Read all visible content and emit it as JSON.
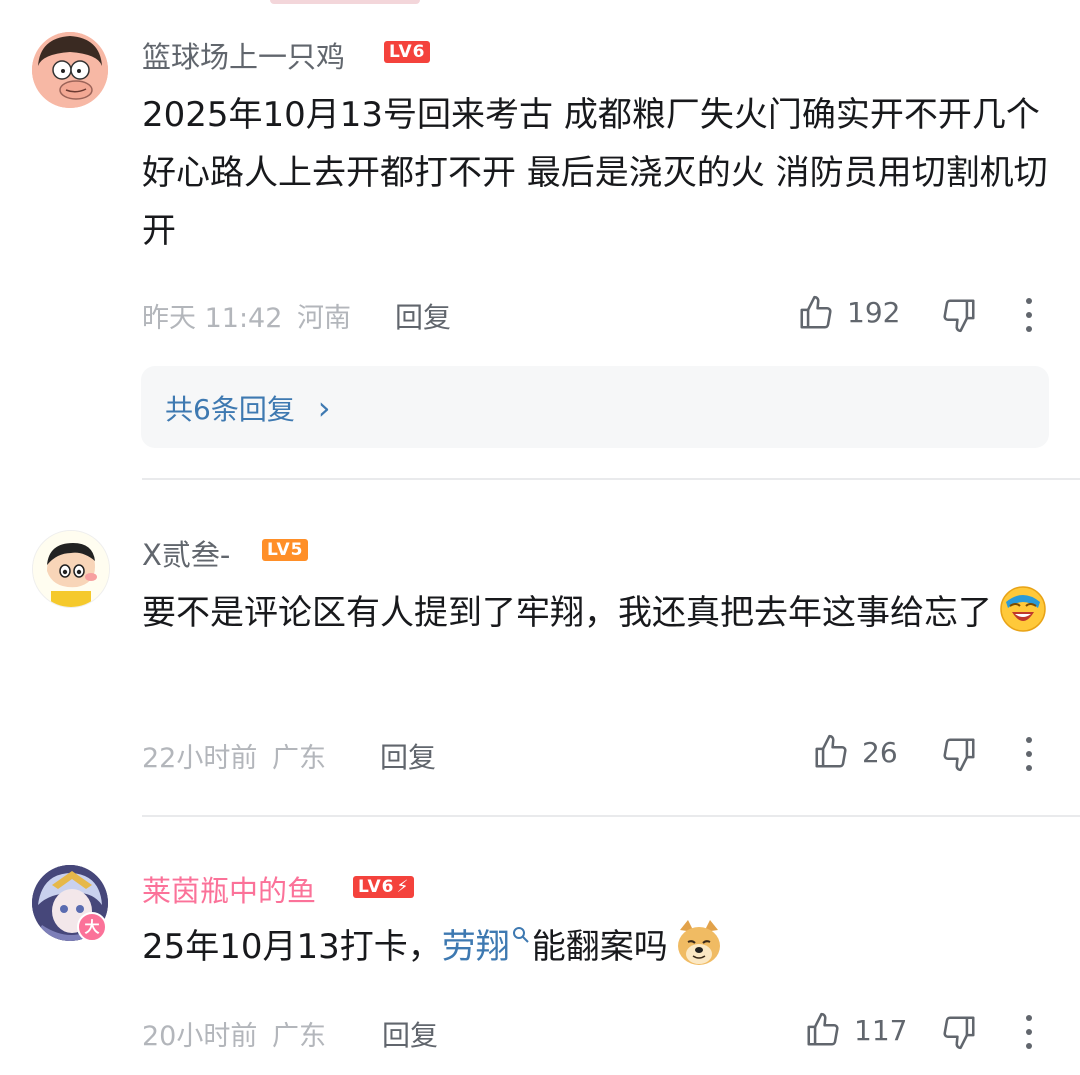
{
  "comments": [
    {
      "username": "篮球场上一只鸡",
      "level": "LV6",
      "text": "2025年10月13号回来考古 成都粮厂失火门确实开不开几个好心路人上去开都打不开 最后是浇灭的火 消防员用切割机切开",
      "time": "昨天 11:42",
      "location": "河南",
      "reply_label": "回复",
      "likes": "192",
      "replies_summary": "共6条回复",
      "replies_arrow": "›"
    },
    {
      "username": "X贰叁-",
      "level": "LV5",
      "text": "要不是评论区有人提到了牢翔，我还真把去年这事给忘了",
      "emoji": "laughing-emoji",
      "time": "22小时前",
      "location": "广东",
      "reply_label": "回复",
      "likes": "26"
    },
    {
      "username": "莱茵瓶中的鱼",
      "level": "LV6",
      "level_extra": "⚡",
      "avatar_badge": "大",
      "text_before": "25年10月13打卡，",
      "search_link": "劳翔",
      "text_after": "能翻案吗",
      "emoji": "doge-emoji",
      "time": "20小时前",
      "location": "广东",
      "reply_label": "回复",
      "likes": "117"
    }
  ],
  "colors": {
    "lv6": "#f4423c",
    "lv5": "#ff8f28",
    "username": "#61666d",
    "username_vip": "#fb7299",
    "link": "#3e79b1",
    "meta": "#b3b6bb"
  }
}
